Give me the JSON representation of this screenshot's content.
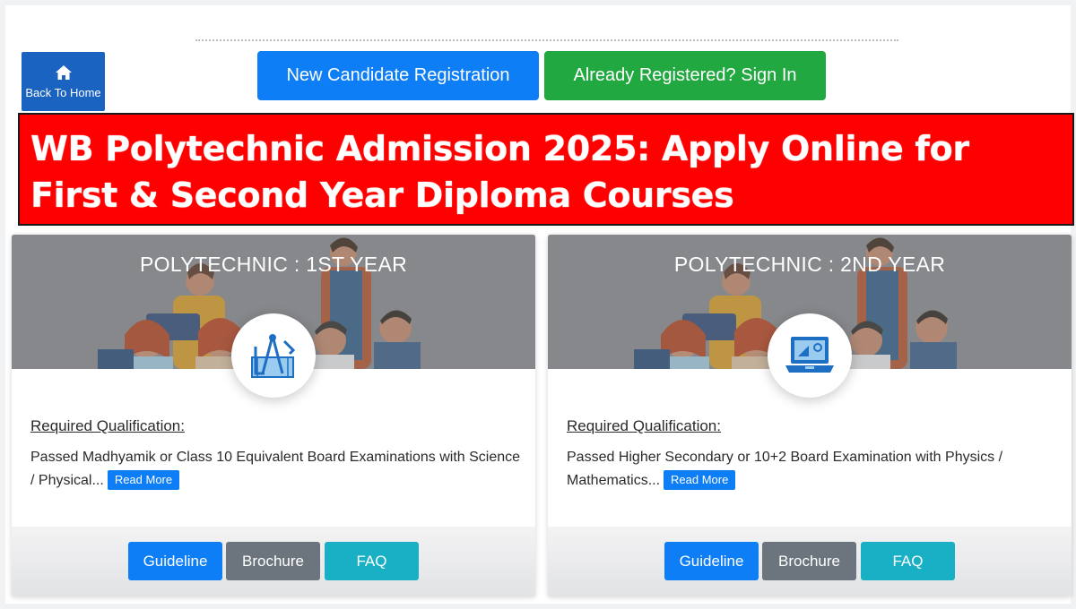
{
  "header": {
    "home_label": "Back To Home",
    "register_label": "New Candidate Registration",
    "signin_label": "Already Registered? Sign In"
  },
  "banner": {
    "title": "WB Polytechnic Admission 2025: Apply Online for First & Second Year Diploma Courses"
  },
  "cards": [
    {
      "title": "POLYTECHNIC : 1ST YEAR",
      "icon": "engineering-tools-icon",
      "qualification_heading": "Required Qualification:",
      "qualification_text": "Passed Madhyamik or Class 10 Equivalent Board Examinations with Science / Physical...",
      "read_more": "Read More",
      "buttons": {
        "guideline": "Guideline",
        "brochure": "Brochure",
        "faq": "FAQ"
      }
    },
    {
      "title": "POLYTECHNIC : 2ND YEAR",
      "icon": "laptop-diagram-icon",
      "qualification_heading": "Required Qualification:",
      "qualification_text": "Passed Higher Secondary or 10+2 Board Examination with Physics / Mathematics...",
      "read_more": "Read More",
      "buttons": {
        "guideline": "Guideline",
        "brochure": "Brochure",
        "faq": "FAQ"
      }
    }
  ],
  "colors": {
    "primary": "#0d7ef5",
    "success": "#21a841",
    "secondary": "#6c757d",
    "info": "#19b0c6",
    "banner": "#ff0000",
    "home": "#1b63c1"
  }
}
